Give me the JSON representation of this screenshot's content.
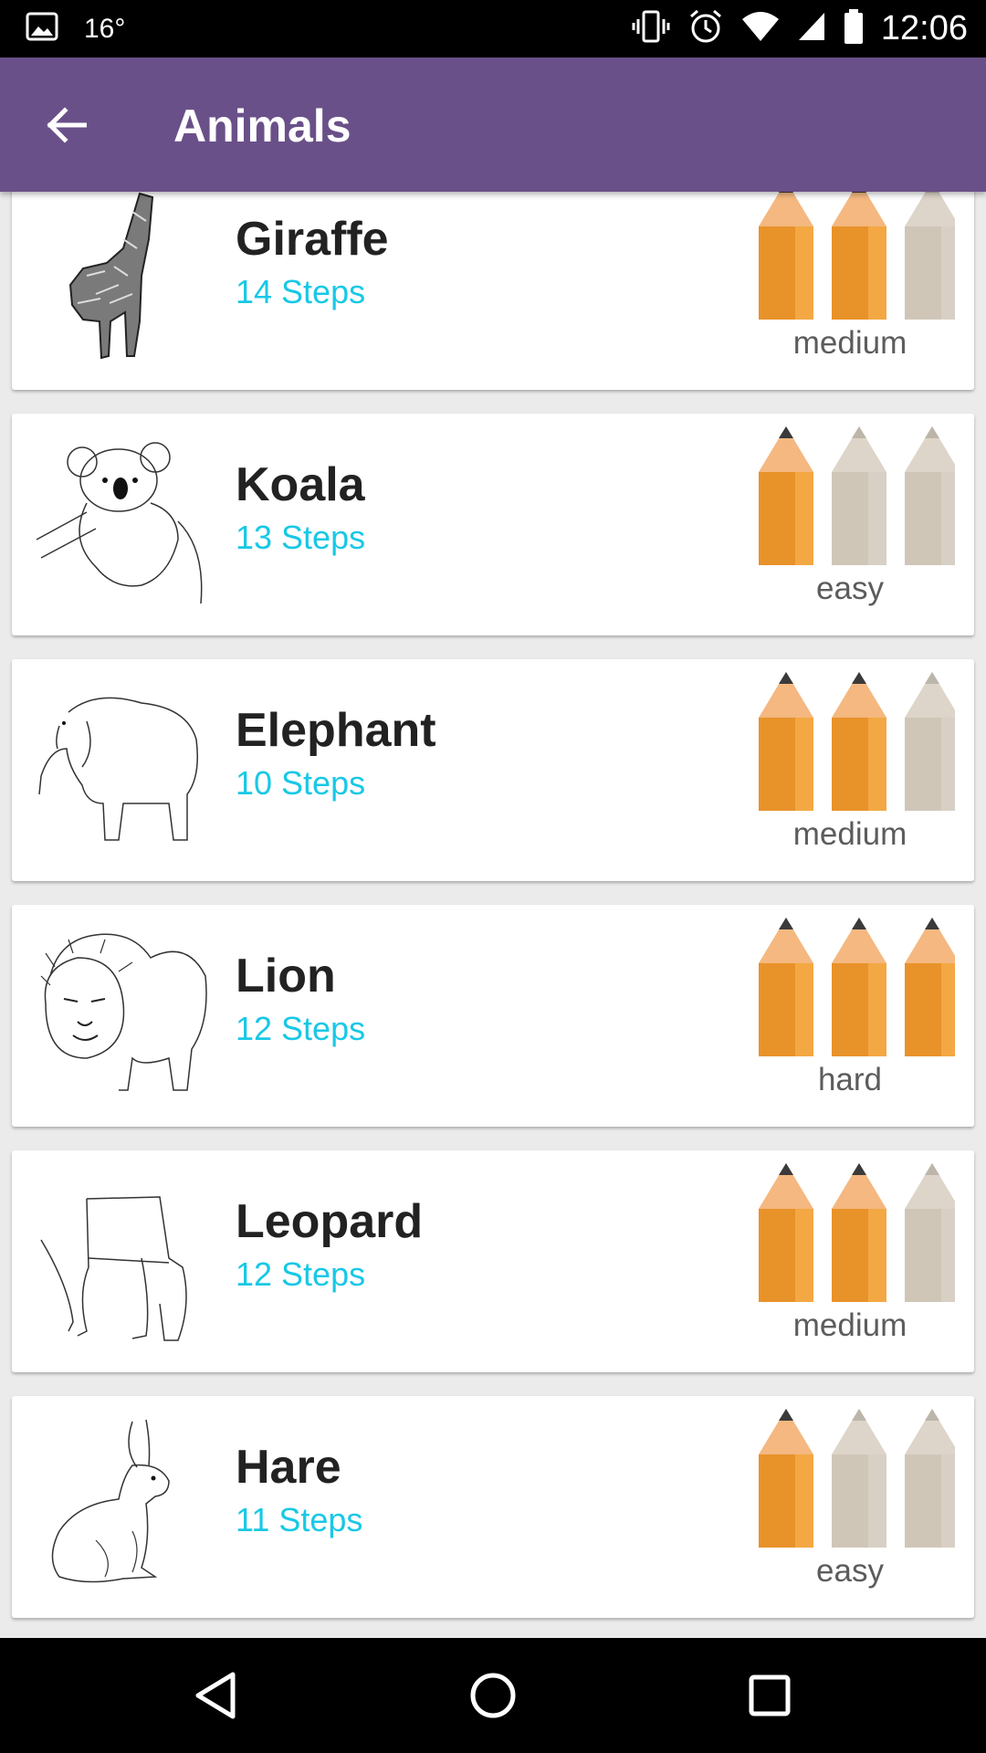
{
  "status_bar": {
    "temperature": "16°",
    "time": "12:06"
  },
  "app_bar": {
    "title": "Animals"
  },
  "items": [
    {
      "name": "Giraffe",
      "steps": "14 Steps",
      "difficulty": "medium",
      "level": 2,
      "max_level": 3
    },
    {
      "name": "Koala",
      "steps": "13 Steps",
      "difficulty": "easy",
      "level": 1,
      "max_level": 3
    },
    {
      "name": "Elephant",
      "steps": "10 Steps",
      "difficulty": "medium",
      "level": 2,
      "max_level": 3
    },
    {
      "name": "Lion",
      "steps": "12 Steps",
      "difficulty": "hard",
      "level": 3,
      "max_level": 3
    },
    {
      "name": "Leopard",
      "steps": "12 Steps",
      "difficulty": "medium",
      "level": 2,
      "max_level": 3
    },
    {
      "name": "Hare",
      "steps": "11 Steps",
      "difficulty": "easy",
      "level": 1,
      "max_level": 3
    }
  ],
  "colors": {
    "app_bar": "#6a5089",
    "steps_text": "#18c8e6",
    "pencil_active": "#e8922a",
    "pencil_inactive": "#cfc6b8"
  }
}
